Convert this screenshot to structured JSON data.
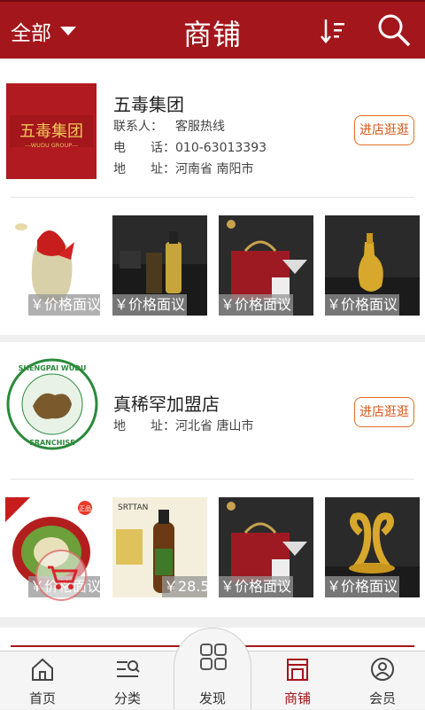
{
  "header": {
    "filter_label": "全部",
    "title": "商铺",
    "icons": [
      "sort-icon",
      "search-icon"
    ]
  },
  "shops": [
    {
      "name": "五毒集团",
      "logo_text": "五毒集团",
      "logo_subtext": "---WUDU GROUP---",
      "contact_label": "联系人：",
      "contact_value": "客服热线",
      "phone_label": "电　　话：",
      "phone_value": "010-63013393",
      "address_label": "地　　址：",
      "address_value": "河南省 南阳市",
      "enter_label": "进店逛逛",
      "products": [
        {
          "price": "￥价格面议",
          "theme": "red-jar"
        },
        {
          "price": "￥价格面议",
          "theme": "dark-box"
        },
        {
          "price": "￥价格面议",
          "theme": "gift-box"
        },
        {
          "price": "￥价格面议",
          "theme": "gold-bottle"
        }
      ]
    },
    {
      "name": "真稀罕加盟店",
      "logo_text": "SHENGPAI WUDU",
      "logo_subtext": "FRANCHISE",
      "address_label": "地　　址：",
      "address_value": "河北省 唐山市",
      "enter_label": "进店逛逛",
      "products": [
        {
          "price": "￥价格面议",
          "theme": "tin",
          "badge": "正品"
        },
        {
          "price": "￥28.5",
          "theme": "shampoo",
          "brand": "SRTTAN"
        },
        {
          "price": "￥价格面议",
          "theme": "gift-box"
        },
        {
          "price": "￥价格面议",
          "theme": "gold-swan"
        }
      ]
    }
  ],
  "tabbar": {
    "items": [
      {
        "label": "首页",
        "icon": "home-icon"
      },
      {
        "label": "分类",
        "icon": "category-icon"
      },
      {
        "label": "发现",
        "icon": "discover-icon"
      },
      {
        "label": "商铺",
        "icon": "shop-icon",
        "active": true
      },
      {
        "label": "会员",
        "icon": "member-icon"
      }
    ]
  },
  "colors": {
    "brand": "#a3161b",
    "accent": "#e36d27",
    "price_bg": "#969696"
  }
}
